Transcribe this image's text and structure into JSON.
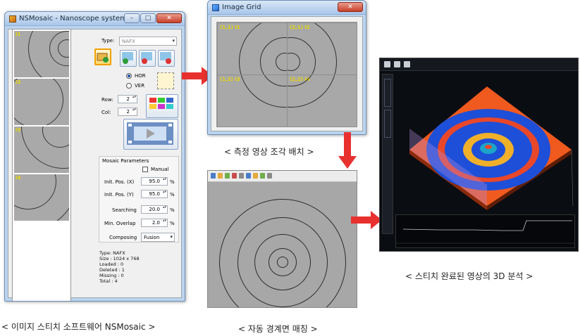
{
  "window1": {
    "title": "NSMosaic - Nanoscope systems",
    "thumbs": [
      "I1",
      "I2",
      "I3",
      "I4"
    ],
    "type_label": "Type:",
    "type_value": "NAFX",
    "hor_label": "HOR",
    "ver_label": "VER",
    "row_label": "Row:",
    "row_value": "2",
    "col_label": "Col:",
    "col_value": "2",
    "mosaic_params_label": "Mosaic Parameters",
    "manual_label": "Manual",
    "init_pos_x_label": "Init. Pos. (X)",
    "init_pos_x_value": "95.0",
    "init_pos_y_label": "Init. Pos. (Y)",
    "init_pos_y_value": "95.0",
    "searching_label": "Searching",
    "searching_value": "20.0",
    "min_overlap_label": "Min. Overlap",
    "min_overlap_value": "2.0",
    "composing_label": "Composing",
    "composing_value": "Fusion",
    "unit": "%",
    "info": [
      "Type: NAFX",
      "Size : 1024 x 768",
      "Loaded : 0",
      "Deleted : 1",
      "Missing : 0",
      "Total : 4"
    ]
  },
  "window2": {
    "title": "Image Grid",
    "cells": [
      "(1,1) I1",
      "(2,1) I2",
      "(1,2) I3",
      "(2,2) I4"
    ]
  },
  "captions": {
    "c1": "< 이미지 스티치 소프트웨어 NSMosaic >",
    "c2": "< 측정 영상 조각 배치 >",
    "c3": "< 자동 경계면 매칭 >",
    "c4": "< 스티치 완료된 영상의 3D 분석 >"
  },
  "colors": {
    "arrow": "#e8312f",
    "highlight": "#f0a000"
  }
}
